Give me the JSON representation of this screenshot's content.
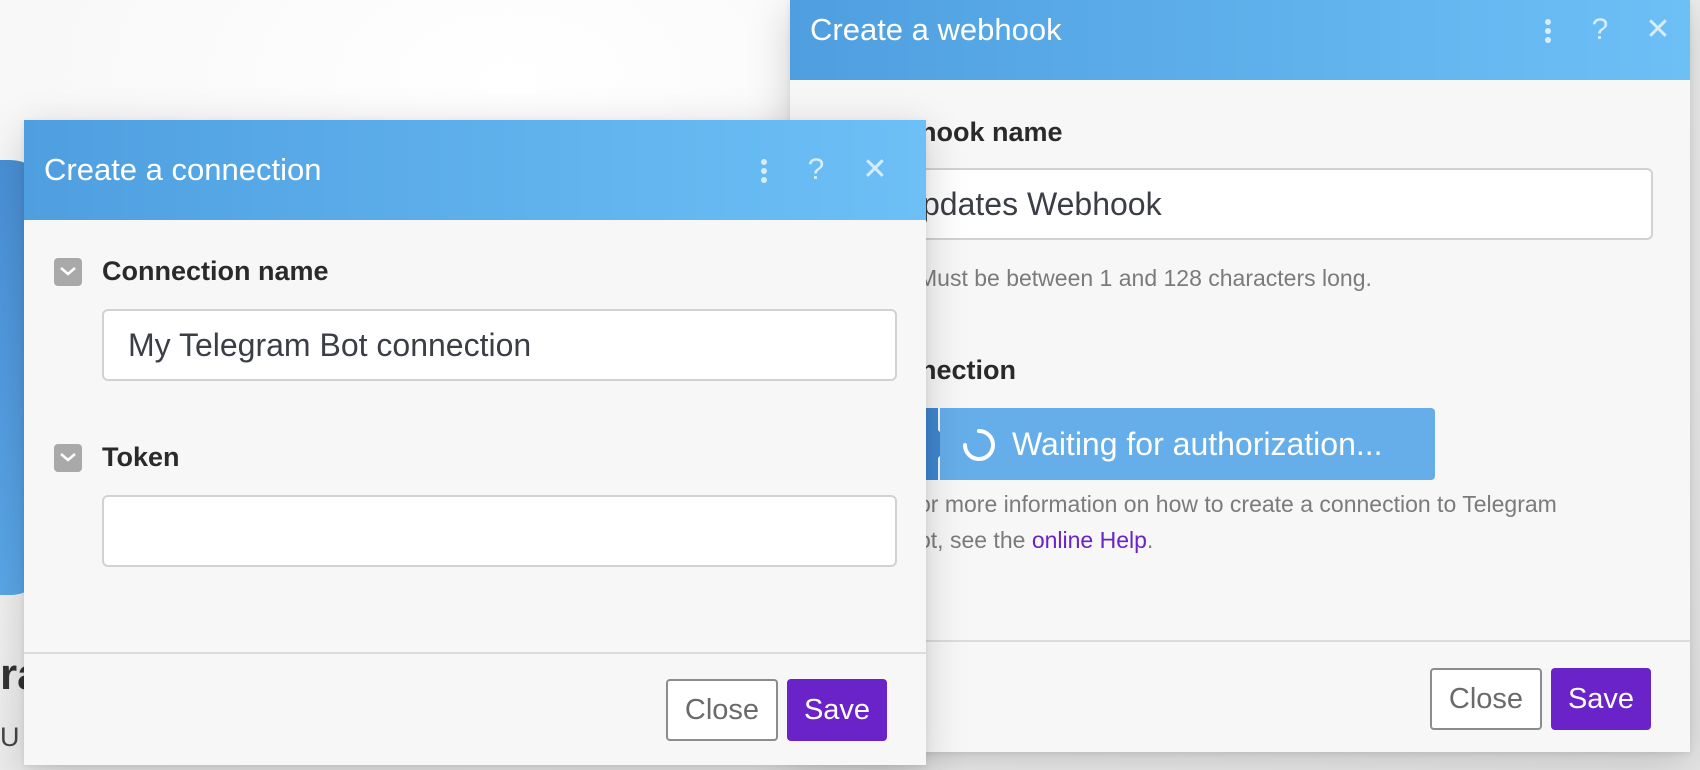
{
  "background": {
    "title_fragment": "ra",
    "subtitle_fragment": "U"
  },
  "webhook_dialog": {
    "title": "Create a webhook",
    "icons": {
      "menu": "more-vertical-icon",
      "help": "help-icon",
      "close": "close-icon"
    },
    "webhook_name": {
      "label": "hook name",
      "value": "pdates Webhook",
      "hint": "Must be between 1 and 128 characters long."
    },
    "connection": {
      "label": "nection",
      "status_button": "Waiting for authorization...",
      "info_line1": "or more information on how to create a connection to Telegram",
      "info_prefix": "ot, see the ",
      "help_link": "online Help",
      "info_suffix": "."
    },
    "buttons": {
      "close": "Close",
      "save": "Save"
    }
  },
  "connection_dialog": {
    "title": "Create a connection",
    "icons": {
      "menu": "more-vertical-icon",
      "help": "help-icon",
      "close": "close-icon"
    },
    "connection_name": {
      "label": "Connection name",
      "value": "My Telegram Bot connection"
    },
    "token": {
      "label": "Token",
      "value": ""
    },
    "buttons": {
      "close": "Close",
      "save": "Save"
    }
  },
  "colors": {
    "header_start": "#4f9fe0",
    "header_end": "#6cc0f6",
    "primary_button": "#6a22c9",
    "link": "#6a22c9",
    "auth_button": "#66aeea"
  }
}
